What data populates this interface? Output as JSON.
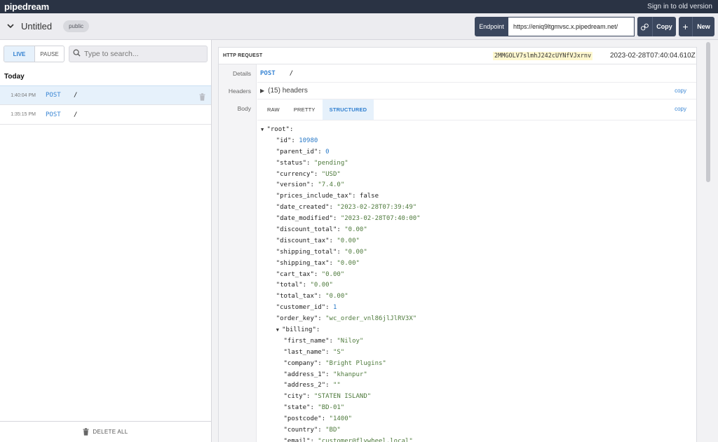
{
  "app": {
    "logo": "pipedream",
    "signin": "Sign in to old version"
  },
  "header": {
    "title": "Untitled",
    "visibility": "public",
    "endpoint_label": "Endpoint",
    "endpoint_url": "https://eniq9ltgmvsc.x.pipedream.net/",
    "copy_label": "Copy",
    "new_label": "New"
  },
  "left": {
    "live_label": "LIVE",
    "pause_label": "PAUSE",
    "search_placeholder": "Type to search...",
    "group_label": "Today",
    "requests": [
      {
        "time": "1:40:04 PM",
        "method": "POST",
        "path": "/"
      },
      {
        "time": "1:35:15 PM",
        "method": "POST",
        "path": "/"
      }
    ],
    "delete_all": "DELETE ALL"
  },
  "request": {
    "section_label": "HTTP REQUEST",
    "request_id": "2MMGOLV7slmhJ242cUYNfVJxrnv",
    "timestamp": "2023-02-28T07:40:04.610Z",
    "details_label": "Details",
    "method": "POST",
    "path": "/",
    "headers_label": "Headers",
    "headers_summary": "(15) headers",
    "body_label": "Body",
    "copy_link": "copy",
    "tabs": [
      "RAW",
      "PRETTY",
      "STRUCTURED"
    ],
    "active_tab": "STRUCTURED"
  },
  "body_tree": [
    {
      "indent": 0,
      "caret": true,
      "key": "\"root\"",
      "sep": ":",
      "val": "",
      "type": "k"
    },
    {
      "indent": 1,
      "key": "\"id\"",
      "sep": ": ",
      "val": "10980",
      "type": "n"
    },
    {
      "indent": 1,
      "key": "\"parent_id\"",
      "sep": ": ",
      "val": "0",
      "type": "n"
    },
    {
      "indent": 1,
      "key": "\"status\"",
      "sep": ": ",
      "val": "\"pending\"",
      "type": "s"
    },
    {
      "indent": 1,
      "key": "\"currency\"",
      "sep": ": ",
      "val": "\"USD\"",
      "type": "s"
    },
    {
      "indent": 1,
      "key": "\"version\"",
      "sep": ": ",
      "val": "\"7.4.0\"",
      "type": "s"
    },
    {
      "indent": 1,
      "key": "\"prices_include_tax\"",
      "sep": ": ",
      "val": "false",
      "type": "b"
    },
    {
      "indent": 1,
      "key": "\"date_created\"",
      "sep": ": ",
      "val": "\"2023-02-28T07:39:49\"",
      "type": "s"
    },
    {
      "indent": 1,
      "key": "\"date_modified\"",
      "sep": ": ",
      "val": "\"2023-02-28T07:40:00\"",
      "type": "s"
    },
    {
      "indent": 1,
      "key": "\"discount_total\"",
      "sep": ": ",
      "val": "\"0.00\"",
      "type": "s"
    },
    {
      "indent": 1,
      "key": "\"discount_tax\"",
      "sep": ": ",
      "val": "\"0.00\"",
      "type": "s"
    },
    {
      "indent": 1,
      "key": "\"shipping_total\"",
      "sep": ": ",
      "val": "\"0.00\"",
      "type": "s"
    },
    {
      "indent": 1,
      "key": "\"shipping_tax\"",
      "sep": ": ",
      "val": "\"0.00\"",
      "type": "s"
    },
    {
      "indent": 1,
      "key": "\"cart_tax\"",
      "sep": ": ",
      "val": "\"0.00\"",
      "type": "s"
    },
    {
      "indent": 1,
      "key": "\"total\"",
      "sep": ": ",
      "val": "\"0.00\"",
      "type": "s"
    },
    {
      "indent": 1,
      "key": "\"total_tax\"",
      "sep": ": ",
      "val": "\"0.00\"",
      "type": "s"
    },
    {
      "indent": 1,
      "key": "\"customer_id\"",
      "sep": ": ",
      "val": "1",
      "type": "n"
    },
    {
      "indent": 1,
      "key": "\"order_key\"",
      "sep": ": ",
      "val": "\"wc_order_vnl86jlJlRV3X\"",
      "type": "s"
    },
    {
      "indent": 1,
      "caret": true,
      "key": "\"billing\"",
      "sep": ":",
      "val": "",
      "type": "k"
    },
    {
      "indent": 2,
      "key": "\"first_name\"",
      "sep": ": ",
      "val": "\"Niloy\"",
      "type": "s"
    },
    {
      "indent": 2,
      "key": "\"last_name\"",
      "sep": ": ",
      "val": "\"S\"",
      "type": "s"
    },
    {
      "indent": 2,
      "key": "\"company\"",
      "sep": ": ",
      "val": "\"Bright Plugins\"",
      "type": "s"
    },
    {
      "indent": 2,
      "key": "\"address_1\"",
      "sep": ": ",
      "val": "\"khanpur\"",
      "type": "s"
    },
    {
      "indent": 2,
      "key": "\"address_2\"",
      "sep": ": ",
      "val": "\"\"",
      "type": "s"
    },
    {
      "indent": 2,
      "key": "\"city\"",
      "sep": ": ",
      "val": "\"STATEN ISLAND\"",
      "type": "s"
    },
    {
      "indent": 2,
      "key": "\"state\"",
      "sep": ": ",
      "val": "\"BD-01\"",
      "type": "s"
    },
    {
      "indent": 2,
      "key": "\"postcode\"",
      "sep": ": ",
      "val": "\"1400\"",
      "type": "s"
    },
    {
      "indent": 2,
      "key": "\"country\"",
      "sep": ": ",
      "val": "\"BD\"",
      "type": "s"
    },
    {
      "indent": 2,
      "key": "\"email\"",
      "sep": ": ",
      "val": "\"customer@flywheel.local\"",
      "type": "s"
    }
  ]
}
